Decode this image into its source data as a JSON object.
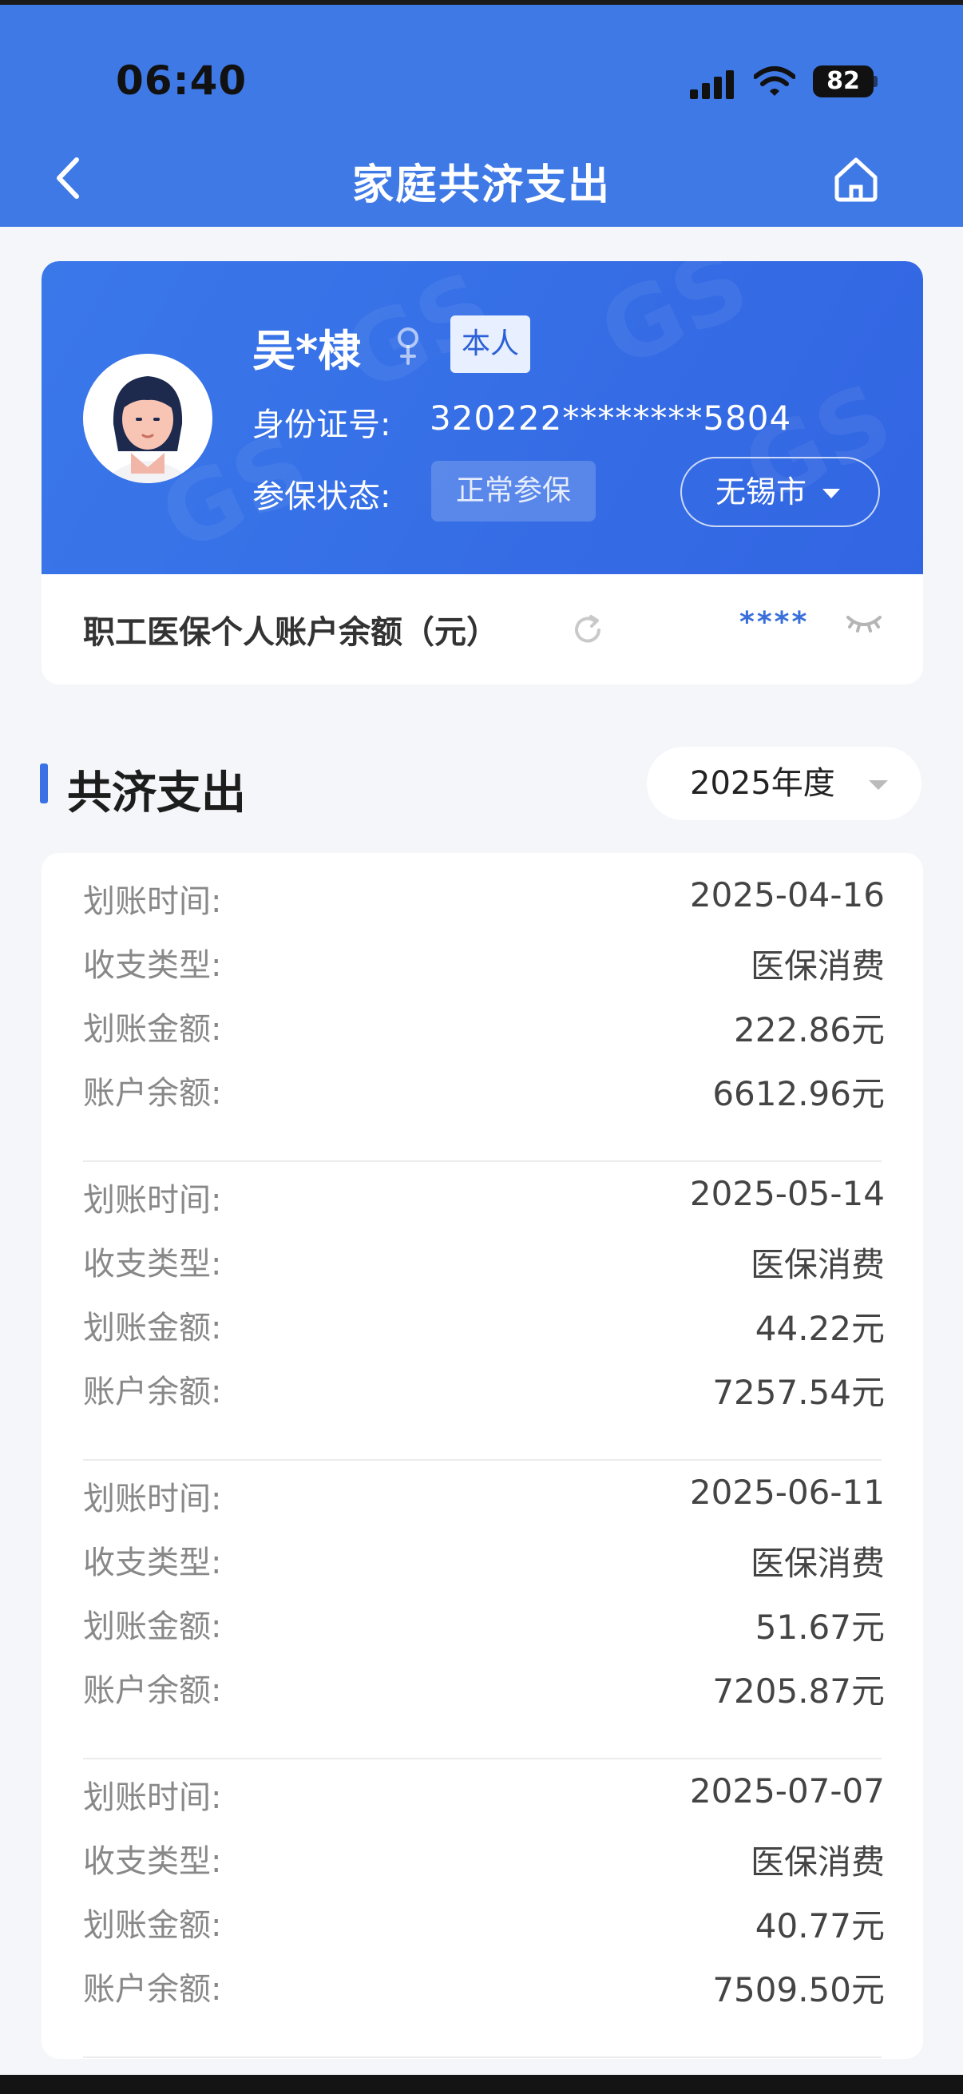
{
  "status_bar": {
    "time": "06:40",
    "battery": "82"
  },
  "nav": {
    "title": "家庭共济支出"
  },
  "profile": {
    "name": "吴*棣",
    "relation_badge": "本人",
    "id_label": "身份证号:",
    "id_value": "320222********5804",
    "status_label": "参保状态:",
    "status_value": "正常参保",
    "city": "无锡市",
    "balance_label": "职工医保个人账户余额（元）",
    "balance_value": "****"
  },
  "section": {
    "title": "共济支出",
    "year": "2025年度"
  },
  "records": [
    {
      "rows": [
        {
          "label": "划账时间:",
          "value": "2025-04-16"
        },
        {
          "label": "收支类型:",
          "value": "医保消费"
        },
        {
          "label": "划账金额:",
          "value": "222.86元"
        },
        {
          "label": "账户余额:",
          "value": "6612.96元"
        }
      ]
    },
    {
      "rows": [
        {
          "label": "划账时间:",
          "value": "2025-05-14"
        },
        {
          "label": "收支类型:",
          "value": "医保消费"
        },
        {
          "label": "划账金额:",
          "value": "44.22元"
        },
        {
          "label": "账户余额:",
          "value": "7257.54元"
        }
      ]
    },
    {
      "rows": [
        {
          "label": "划账时间:",
          "value": "2025-06-11"
        },
        {
          "label": "收支类型:",
          "value": "医保消费"
        },
        {
          "label": "划账金额:",
          "value": "51.67元"
        },
        {
          "label": "账户余额:",
          "value": "7205.87元"
        }
      ]
    },
    {
      "rows": [
        {
          "label": "划账时间:",
          "value": "2025-07-07"
        },
        {
          "label": "收支类型:",
          "value": "医保消费"
        },
        {
          "label": "划账金额:",
          "value": "40.77元"
        },
        {
          "label": "账户余额:",
          "value": "7509.50元"
        }
      ]
    }
  ],
  "icons": [
    "back-icon",
    "home-icon",
    "female-icon",
    "refresh-icon",
    "eye-closed-icon",
    "chevron-down-icon"
  ],
  "colors": {
    "primary": "#3f79e6",
    "accent_text": "#3a6fdb"
  }
}
